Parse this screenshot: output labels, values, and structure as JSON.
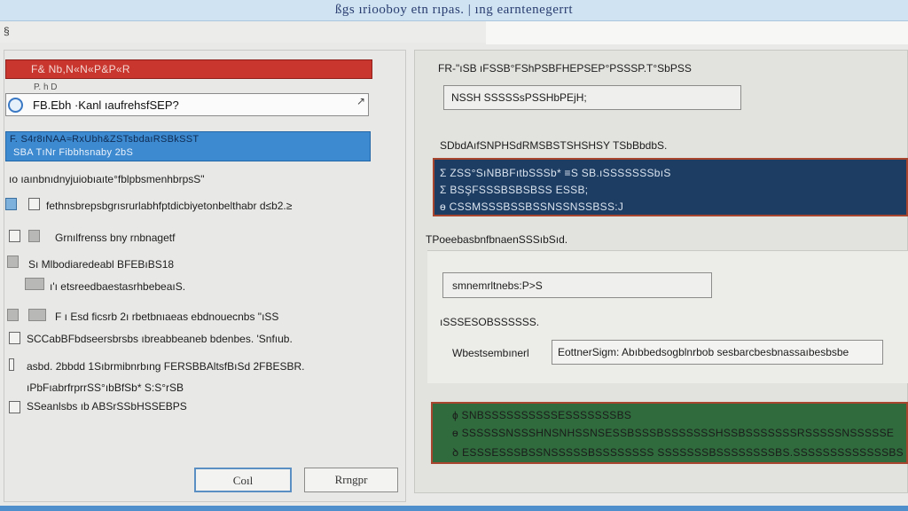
{
  "window": {
    "title": "ßgs ıriooboy etn rıpas. | ıng earntenegerrt"
  },
  "menubar": {
    "glyph": "§"
  },
  "left": {
    "red_bar_label": "F& Nb,N«N«P&P«R",
    "subcaption": "P.    h    D",
    "input_value": "FB.Ebh ·Kanl ıaufrehsfSEP?",
    "blue_bar_line1": "F. S4r8ıNAA≈RxUbh&ZSTsbdaıRSBkSST",
    "blue_bar_line2": "SBA TıNr Fibbhsnaby 2bS",
    "heading": "ıo ıaınbnıdnyjuiobıaıte°fblpbsmenhbrpsS\"",
    "rows": [
      "fethnsbrepsbgrısrurlabhfptdicbiyetonbelthabr d≤b2.≥",
      "Grnılfrenss bny rnbnagetf",
      "Sı Mlbodiaredeabl BFEBıBS18",
      "ı'ı etsreedbaestasrhbebeaıS.",
      "F ı Esd ficsrb 2ı rbetbnıaeas ebdnouecnbs \"ıSS",
      "SCCabBFbdseersbrsbs ıbreabbeaneb bdenbes. 'Snfıub.",
      "asbd. 2bbdd 1Sıbrmibnrbıng FERSBBAltsfBıSd 2FBESBR.",
      "ıPbFıabrfrprrSS°ıbBfSb* S:S°rSB",
      "SSeanlsbs ıb ABSrSSbHSSEBPS"
    ],
    "ok_button": "Coıl",
    "cancel_button": "Rrngpr"
  },
  "right": {
    "caption1": "FR-\"ıSB ıFSSB°FShPSBFHEPSEP°PSSSP.T°SbPSS",
    "field1_value": "NSSH SSSSSsPSSHbPEjH;",
    "caption2": "SDbdAıfSNPHSdRMSBSTSHSHSY TSbBbdbS.",
    "navy_lines": [
      "Σ  ZSS°SıNBBFıtbSSSb*   ≡S SB.ıSSSSSSSbıS",
      "Σ  BSŞFSSSBSBSBSS  ESSB;",
      "ɵ  CSSMSSSBSSBSSNSSNSSBSS:J"
    ],
    "caption3": "TPoeebasbnfbnaenSSSıbSıd.",
    "field2_value": "smnemrltnebs:P>S",
    "caption4": "ıSSSESOBSSSSSS.",
    "label_field3": "Wbestsembınerl",
    "field3_value": "EottnerSigm: Abıbbedsogblnrbob  sesbarcbesbnassaıbesbsbe",
    "green_lines": [
      "ɸ  SNBSSSSSSSSSSESSSSSSSBS",
      "ɵ  SSSSSSNSSSHNSNHSSNSESSBSSSBSSSSSSSHSSBSSSSSSSRSSSSSNSSSSSE",
      "ꝺ  ESSSESSSBSSNSSSSSBSSSSSSSS SSSSSSSBSSSSSSSSBS.SSSSSSSSSSSSSBS"
    ]
  },
  "colors": {
    "red_accent": "#c8362e",
    "blue_accent": "#3e8ad0",
    "navy_panel": "#1e3d63",
    "green_panel": "#2f6b3c",
    "border_accent": "#a8452e"
  }
}
